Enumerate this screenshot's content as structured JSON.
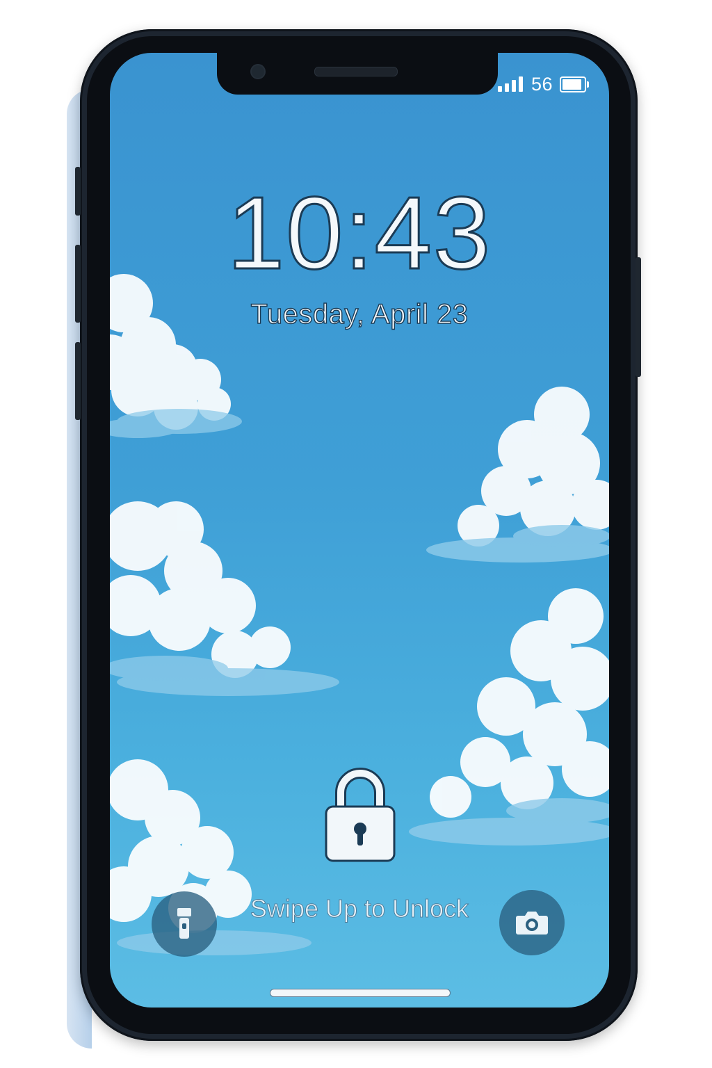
{
  "status_bar": {
    "network_label": "56",
    "signal_bars": 4,
    "battery_level": 0.95,
    "icons": [
      "signal-icon",
      "battery-icon"
    ]
  },
  "lock_screen": {
    "time": "10:43",
    "date": "Tuesday, April 23",
    "lock_icon": "padlock-icon",
    "hint": "Swipe Up to Unlock"
  },
  "quick_actions": {
    "left": {
      "icon": "flashlight-icon"
    },
    "right": {
      "icon": "camera-icon"
    }
  },
  "colors": {
    "sky": "#3f9fd6",
    "text": "#f4f8fb",
    "outline": "#1b3b55",
    "quick_button": "#2a6080",
    "phone_frame": "#1d2530"
  }
}
